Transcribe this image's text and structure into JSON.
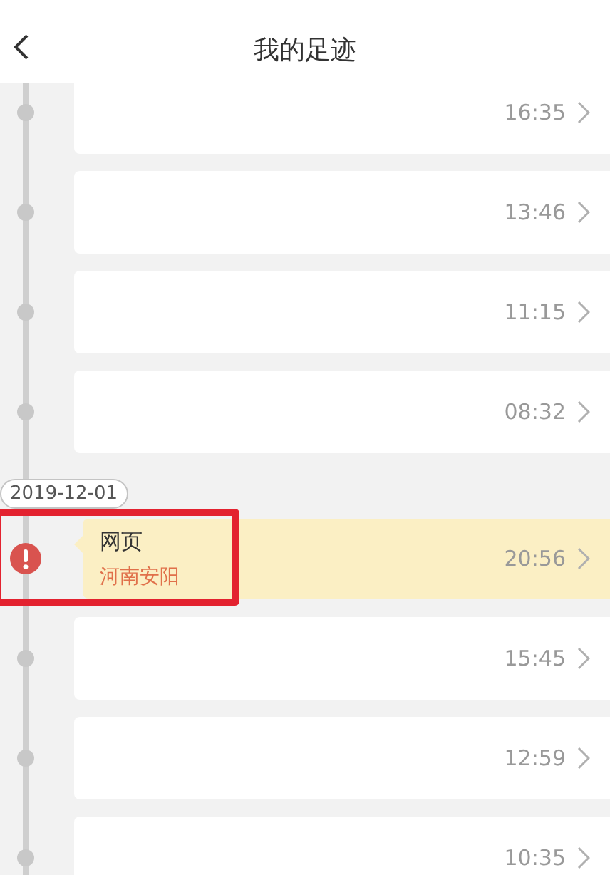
{
  "header": {
    "title": "我的足迹"
  },
  "timeline": [
    {
      "kind": "entry",
      "time": "16:35",
      "alert": false,
      "marked": false
    },
    {
      "kind": "entry",
      "time": "13:46",
      "alert": false,
      "marked": false
    },
    {
      "kind": "entry",
      "time": "11:15",
      "alert": false,
      "marked": false
    },
    {
      "kind": "entry",
      "time": "08:32",
      "alert": false,
      "marked": false
    },
    {
      "kind": "date",
      "label": "2019-12-01"
    },
    {
      "kind": "entry",
      "title": "网页",
      "place": "河南安阳",
      "time": "20:56",
      "alert": true,
      "marked": true
    },
    {
      "kind": "entry",
      "time": "15:45",
      "alert": false,
      "marked": false
    },
    {
      "kind": "entry",
      "time": "12:59",
      "alert": false,
      "marked": false
    },
    {
      "kind": "entry",
      "time": "10:35",
      "alert": false,
      "marked": false
    }
  ]
}
